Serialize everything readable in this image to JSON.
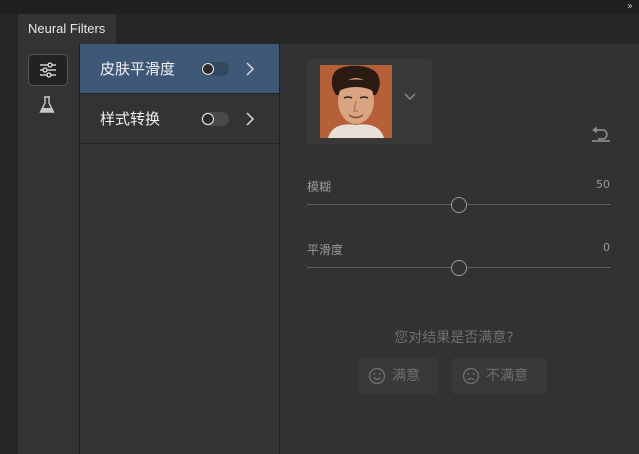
{
  "panel": {
    "title": "Neural Filters",
    "collapse_glyph": "››"
  },
  "tools": [
    {
      "icon": "sliders-icon",
      "active": true
    },
    {
      "icon": "flask-icon",
      "active": false
    }
  ],
  "filters": [
    {
      "label": "皮肤平滑度",
      "enabled": false,
      "active": true
    },
    {
      "label": "样式转换",
      "enabled": false,
      "active": false
    }
  ],
  "settings": {
    "sliders": [
      {
        "label": "模糊",
        "value": "50",
        "fraction": 0.5
      },
      {
        "label": "平滑度",
        "value": "0",
        "fraction": 0.5
      }
    ]
  },
  "feedback": {
    "question": "您对结果是否满意?",
    "satisfied": "满意",
    "unsatisfied": "不满意"
  },
  "colors": {
    "active_row": "#3f5878",
    "panel_bg": "#333333",
    "content_bg": "#323232"
  }
}
